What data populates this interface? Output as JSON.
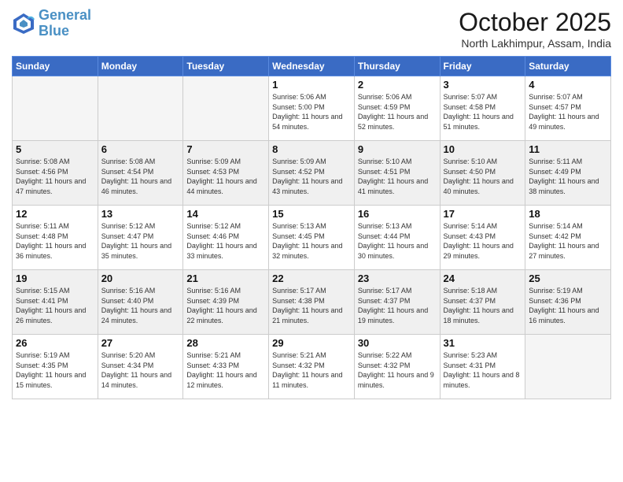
{
  "logo": {
    "line1": "General",
    "line2": "Blue"
  },
  "title": "October 2025",
  "location": "North Lakhimpur, Assam, India",
  "weekdays": [
    "Sunday",
    "Monday",
    "Tuesday",
    "Wednesday",
    "Thursday",
    "Friday",
    "Saturday"
  ],
  "weeks": [
    [
      {
        "day": "",
        "sunrise": "",
        "sunset": "",
        "daylight": ""
      },
      {
        "day": "",
        "sunrise": "",
        "sunset": "",
        "daylight": ""
      },
      {
        "day": "",
        "sunrise": "",
        "sunset": "",
        "daylight": ""
      },
      {
        "day": "1",
        "sunrise": "Sunrise: 5:06 AM",
        "sunset": "Sunset: 5:00 PM",
        "daylight": "Daylight: 11 hours and 54 minutes."
      },
      {
        "day": "2",
        "sunrise": "Sunrise: 5:06 AM",
        "sunset": "Sunset: 4:59 PM",
        "daylight": "Daylight: 11 hours and 52 minutes."
      },
      {
        "day": "3",
        "sunrise": "Sunrise: 5:07 AM",
        "sunset": "Sunset: 4:58 PM",
        "daylight": "Daylight: 11 hours and 51 minutes."
      },
      {
        "day": "4",
        "sunrise": "Sunrise: 5:07 AM",
        "sunset": "Sunset: 4:57 PM",
        "daylight": "Daylight: 11 hours and 49 minutes."
      }
    ],
    [
      {
        "day": "5",
        "sunrise": "Sunrise: 5:08 AM",
        "sunset": "Sunset: 4:56 PM",
        "daylight": "Daylight: 11 hours and 47 minutes."
      },
      {
        "day": "6",
        "sunrise": "Sunrise: 5:08 AM",
        "sunset": "Sunset: 4:54 PM",
        "daylight": "Daylight: 11 hours and 46 minutes."
      },
      {
        "day": "7",
        "sunrise": "Sunrise: 5:09 AM",
        "sunset": "Sunset: 4:53 PM",
        "daylight": "Daylight: 11 hours and 44 minutes."
      },
      {
        "day": "8",
        "sunrise": "Sunrise: 5:09 AM",
        "sunset": "Sunset: 4:52 PM",
        "daylight": "Daylight: 11 hours and 43 minutes."
      },
      {
        "day": "9",
        "sunrise": "Sunrise: 5:10 AM",
        "sunset": "Sunset: 4:51 PM",
        "daylight": "Daylight: 11 hours and 41 minutes."
      },
      {
        "day": "10",
        "sunrise": "Sunrise: 5:10 AM",
        "sunset": "Sunset: 4:50 PM",
        "daylight": "Daylight: 11 hours and 40 minutes."
      },
      {
        "day": "11",
        "sunrise": "Sunrise: 5:11 AM",
        "sunset": "Sunset: 4:49 PM",
        "daylight": "Daylight: 11 hours and 38 minutes."
      }
    ],
    [
      {
        "day": "12",
        "sunrise": "Sunrise: 5:11 AM",
        "sunset": "Sunset: 4:48 PM",
        "daylight": "Daylight: 11 hours and 36 minutes."
      },
      {
        "day": "13",
        "sunrise": "Sunrise: 5:12 AM",
        "sunset": "Sunset: 4:47 PM",
        "daylight": "Daylight: 11 hours and 35 minutes."
      },
      {
        "day": "14",
        "sunrise": "Sunrise: 5:12 AM",
        "sunset": "Sunset: 4:46 PM",
        "daylight": "Daylight: 11 hours and 33 minutes."
      },
      {
        "day": "15",
        "sunrise": "Sunrise: 5:13 AM",
        "sunset": "Sunset: 4:45 PM",
        "daylight": "Daylight: 11 hours and 32 minutes."
      },
      {
        "day": "16",
        "sunrise": "Sunrise: 5:13 AM",
        "sunset": "Sunset: 4:44 PM",
        "daylight": "Daylight: 11 hours and 30 minutes."
      },
      {
        "day": "17",
        "sunrise": "Sunrise: 5:14 AM",
        "sunset": "Sunset: 4:43 PM",
        "daylight": "Daylight: 11 hours and 29 minutes."
      },
      {
        "day": "18",
        "sunrise": "Sunrise: 5:14 AM",
        "sunset": "Sunset: 4:42 PM",
        "daylight": "Daylight: 11 hours and 27 minutes."
      }
    ],
    [
      {
        "day": "19",
        "sunrise": "Sunrise: 5:15 AM",
        "sunset": "Sunset: 4:41 PM",
        "daylight": "Daylight: 11 hours and 26 minutes."
      },
      {
        "day": "20",
        "sunrise": "Sunrise: 5:16 AM",
        "sunset": "Sunset: 4:40 PM",
        "daylight": "Daylight: 11 hours and 24 minutes."
      },
      {
        "day": "21",
        "sunrise": "Sunrise: 5:16 AM",
        "sunset": "Sunset: 4:39 PM",
        "daylight": "Daylight: 11 hours and 22 minutes."
      },
      {
        "day": "22",
        "sunrise": "Sunrise: 5:17 AM",
        "sunset": "Sunset: 4:38 PM",
        "daylight": "Daylight: 11 hours and 21 minutes."
      },
      {
        "day": "23",
        "sunrise": "Sunrise: 5:17 AM",
        "sunset": "Sunset: 4:37 PM",
        "daylight": "Daylight: 11 hours and 19 minutes."
      },
      {
        "day": "24",
        "sunrise": "Sunrise: 5:18 AM",
        "sunset": "Sunset: 4:37 PM",
        "daylight": "Daylight: 11 hours and 18 minutes."
      },
      {
        "day": "25",
        "sunrise": "Sunrise: 5:19 AM",
        "sunset": "Sunset: 4:36 PM",
        "daylight": "Daylight: 11 hours and 16 minutes."
      }
    ],
    [
      {
        "day": "26",
        "sunrise": "Sunrise: 5:19 AM",
        "sunset": "Sunset: 4:35 PM",
        "daylight": "Daylight: 11 hours and 15 minutes."
      },
      {
        "day": "27",
        "sunrise": "Sunrise: 5:20 AM",
        "sunset": "Sunset: 4:34 PM",
        "daylight": "Daylight: 11 hours and 14 minutes."
      },
      {
        "day": "28",
        "sunrise": "Sunrise: 5:21 AM",
        "sunset": "Sunset: 4:33 PM",
        "daylight": "Daylight: 11 hours and 12 minutes."
      },
      {
        "day": "29",
        "sunrise": "Sunrise: 5:21 AM",
        "sunset": "Sunset: 4:32 PM",
        "daylight": "Daylight: 11 hours and 11 minutes."
      },
      {
        "day": "30",
        "sunrise": "Sunrise: 5:22 AM",
        "sunset": "Sunset: 4:32 PM",
        "daylight": "Daylight: 11 hours and 9 minutes."
      },
      {
        "day": "31",
        "sunrise": "Sunrise: 5:23 AM",
        "sunset": "Sunset: 4:31 PM",
        "daylight": "Daylight: 11 hours and 8 minutes."
      },
      {
        "day": "",
        "sunrise": "",
        "sunset": "",
        "daylight": ""
      }
    ]
  ]
}
